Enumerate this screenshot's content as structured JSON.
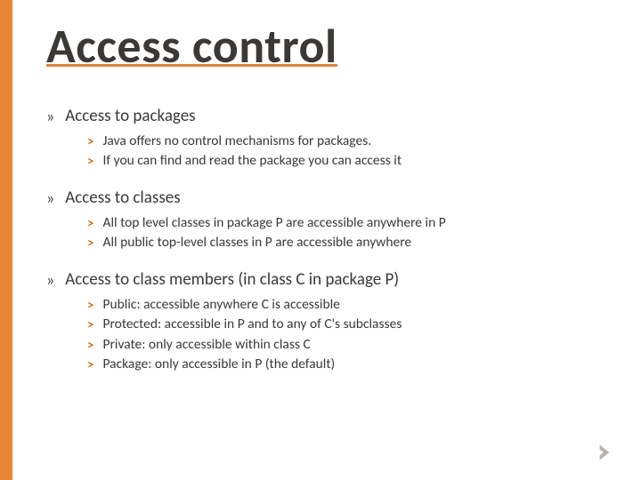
{
  "title": "Access control",
  "sections": [
    {
      "heading": "Access to packages",
      "items": [
        "Java offers no control mechanisms for packages.",
        "If you can find and read the package you can access it"
      ]
    },
    {
      "heading": "Access to classes",
      "items": [
        "All top level classes in package P are accessible anywhere in P",
        "All public top-level classes in P are accessible anywhere"
      ]
    },
    {
      "heading": "Access to class members (in class C in package P)",
      "items": [
        "Public: accessible anywhere C is accessible",
        "Protected: accessible in P and to any of C's subclasses",
        "Private: only accessible within class C",
        "Package: only accessible in P (the default)"
      ]
    }
  ]
}
